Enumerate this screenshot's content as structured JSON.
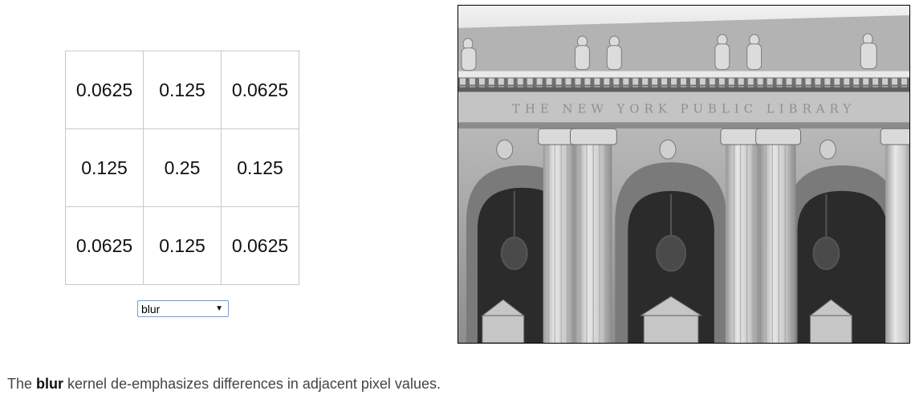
{
  "kernel": {
    "values": [
      [
        "0.0625",
        "0.125",
        "0.0625"
      ],
      [
        "0.125",
        "0.25",
        "0.125"
      ],
      [
        "0.0625",
        "0.125",
        "0.0625"
      ]
    ]
  },
  "selector": {
    "selected": "blur"
  },
  "caption": {
    "prefix": "The ",
    "kernel_name": "blur",
    "suffix": " kernel de-emphasizes differences in adjacent pixel values."
  },
  "photo": {
    "inscription": "THE NEW YORK PUBLIC LIBRARY"
  }
}
